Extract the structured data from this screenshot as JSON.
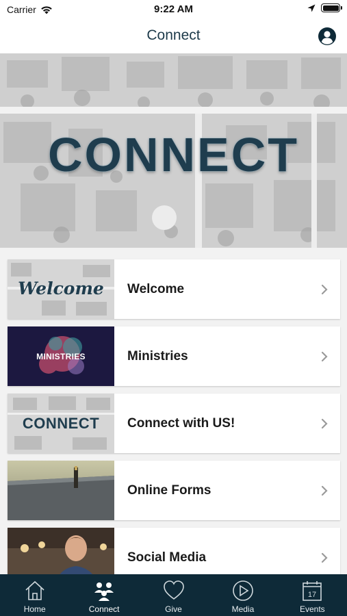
{
  "status_bar": {
    "carrier": "Carrier",
    "time": "9:22 AM"
  },
  "nav": {
    "title": "Connect"
  },
  "hero": {
    "word": "CONNECT"
  },
  "items": [
    {
      "label": "Welcome",
      "thumb_text": "Welcome"
    },
    {
      "label": "Ministries",
      "thumb_text": "MINISTRIES"
    },
    {
      "label": "Connect with US!",
      "thumb_text": "CONNECT"
    },
    {
      "label": "Online Forms"
    },
    {
      "label": "Social Media"
    }
  ],
  "tabs": [
    {
      "label": "Home",
      "icon": "home-icon"
    },
    {
      "label": "Connect",
      "icon": "people-icon",
      "active": true
    },
    {
      "label": "Give",
      "icon": "heart-icon"
    },
    {
      "label": "Media",
      "icon": "play-icon"
    },
    {
      "label": "Events",
      "icon": "calendar-icon",
      "day": "17"
    }
  ],
  "colors": {
    "nav_title": "#1d3a4a",
    "tab_bar": "#0e2a38",
    "brand_text": "#1f3d4e"
  }
}
